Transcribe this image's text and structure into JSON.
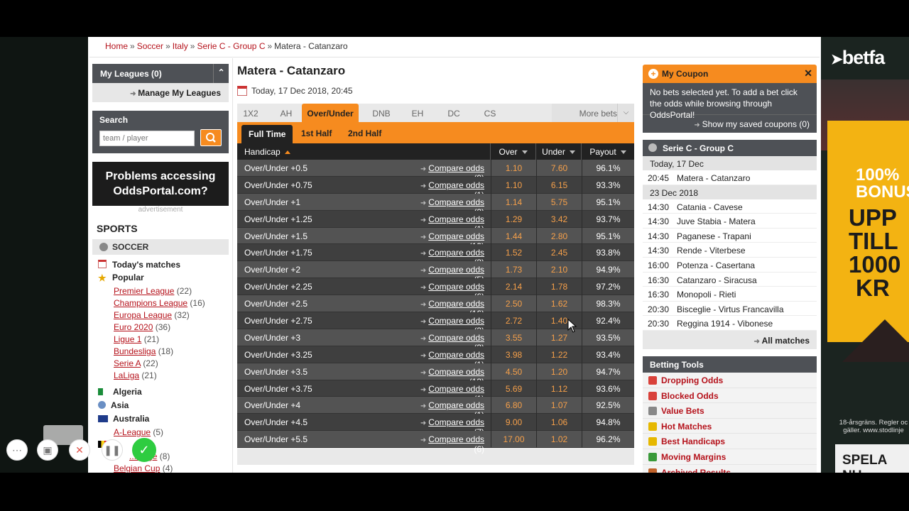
{
  "breadcrumb": [
    {
      "label": "Home"
    },
    {
      "label": "Soccer"
    },
    {
      "label": "Italy"
    },
    {
      "label": "Serie C - Group C"
    }
  ],
  "breadcrumb_current": "Matera - Catanzaro",
  "breadcrumb_sep": "»",
  "left": {
    "my_leagues": "My Leagues (0)",
    "manage": "Manage My Leagues",
    "search_title": "Search",
    "search_placeholder": "team / player",
    "problems": "Problems accessing OddsPortal.com?",
    "advertisement": "advertisement",
    "sports": "SPORTS",
    "soccer": "SOCCER",
    "todays_matches": "Today's matches",
    "popular": "Popular",
    "leagues": [
      {
        "name": "Premier League",
        "count": "(22)"
      },
      {
        "name": "Champions League",
        "count": "(16)"
      },
      {
        "name": "Europa League",
        "count": "(32)"
      },
      {
        "name": "Euro 2020",
        "count": "(36)"
      },
      {
        "name": "Ligue 1",
        "count": "(21)"
      },
      {
        "name": "Bundesliga",
        "count": "(18)"
      },
      {
        "name": "Serie A",
        "count": "(22)"
      },
      {
        "name": "LaLiga",
        "count": "(21)"
      }
    ],
    "countries": [
      "Algeria",
      "Asia",
      "Australia"
    ],
    "aus_league": {
      "name": "A-League",
      "count": "(5)"
    },
    "partial1": {
      "name": "...lenge",
      "count": "(8)"
    },
    "partial2": {
      "name": "Belgian Cup",
      "count": "(4)"
    }
  },
  "match": {
    "title": "Matera - Catanzaro",
    "date": "Today, 17 Dec 2018, 20:45"
  },
  "tabs": [
    "1X2",
    "AH",
    "Over/Under",
    "DNB",
    "EH",
    "DC",
    "CS"
  ],
  "active_tab": "Over/Under",
  "more_bets": "More bets",
  "subtabs": [
    "Full Time",
    "1st Half",
    "2nd Half"
  ],
  "table": {
    "headers": {
      "handicap": "Handicap",
      "over": "Over",
      "under": "Under",
      "payout": "Payout"
    },
    "compare_label": "Compare odds",
    "rows": [
      {
        "name": "Over/Under +0.5",
        "n": "(9)",
        "over": "1.10",
        "under": "7.60",
        "payout": "96.1%"
      },
      {
        "name": "Over/Under +0.75",
        "n": "(1)",
        "over": "1.10",
        "under": "6.15",
        "payout": "93.3%"
      },
      {
        "name": "Over/Under +1",
        "n": "(2)",
        "over": "1.14",
        "under": "5.75",
        "payout": "95.1%"
      },
      {
        "name": "Over/Under +1.25",
        "n": "(1)",
        "over": "1.29",
        "under": "3.42",
        "payout": "93.7%"
      },
      {
        "name": "Over/Under +1.5",
        "n": "(13)",
        "over": "1.44",
        "under": "2.80",
        "payout": "95.1%"
      },
      {
        "name": "Over/Under +1.75",
        "n": "(3)",
        "over": "1.52",
        "under": "2.45",
        "payout": "93.8%"
      },
      {
        "name": "Over/Under +2",
        "n": "(5)",
        "over": "1.73",
        "under": "2.10",
        "payout": "94.9%"
      },
      {
        "name": "Over/Under +2.25",
        "n": "(6)",
        "over": "2.14",
        "under": "1.78",
        "payout": "97.2%"
      },
      {
        "name": "Over/Under +2.5",
        "n": "(16)",
        "over": "2.50",
        "under": "1.62",
        "payout": "98.3%"
      },
      {
        "name": "Over/Under +2.75",
        "n": "(3)",
        "over": "2.72",
        "under": "1.40",
        "payout": "92.4%"
      },
      {
        "name": "Over/Under +3",
        "n": "(3)",
        "over": "3.55",
        "under": "1.27",
        "payout": "93.5%"
      },
      {
        "name": "Over/Under +3.25",
        "n": "(1)",
        "over": "3.98",
        "under": "1.22",
        "payout": "93.4%"
      },
      {
        "name": "Over/Under +3.5",
        "n": "(13)",
        "over": "4.50",
        "under": "1.20",
        "payout": "94.7%"
      },
      {
        "name": "Over/Under +3.75",
        "n": "(1)",
        "over": "5.69",
        "under": "1.12",
        "payout": "93.6%"
      },
      {
        "name": "Over/Under +4",
        "n": "(1)",
        "over": "6.80",
        "under": "1.07",
        "payout": "92.5%"
      },
      {
        "name": "Over/Under +4.5",
        "n": "(7)",
        "over": "9.00",
        "under": "1.06",
        "payout": "94.8%"
      },
      {
        "name": "Over/Under +5.5",
        "n": "(6)",
        "over": "17.00",
        "under": "1.02",
        "payout": "96.2%"
      }
    ]
  },
  "coupon": {
    "title": "My Coupon",
    "body": "No bets selected yet. To add a bet click the odds while browsing through OddsPortal!",
    "saved": "Show my saved coupons (0)"
  },
  "league_box": {
    "title": "Serie C - Group C",
    "day1": "Today, 17 Dec",
    "day1_matches": [
      {
        "time": "20:45",
        "teams": "Matera - Catanzaro"
      }
    ],
    "day2": "23 Dec 2018",
    "day2_matches": [
      {
        "time": "14:30",
        "teams": "Catania - Cavese"
      },
      {
        "time": "14:30",
        "teams": "Juve Stabia - Matera"
      },
      {
        "time": "14:30",
        "teams": "Paganese - Trapani"
      },
      {
        "time": "14:30",
        "teams": "Rende - Viterbese"
      },
      {
        "time": "16:00",
        "teams": "Potenza - Casertana"
      },
      {
        "time": "16:30",
        "teams": "Catanzaro - Siracusa"
      },
      {
        "time": "16:30",
        "teams": "Monopoli - Rieti"
      },
      {
        "time": "20:30",
        "teams": "Bisceglie - Virtus Francavilla"
      },
      {
        "time": "20:30",
        "teams": "Reggina 1914 - Vibonese"
      }
    ],
    "all_matches": "All matches"
  },
  "tools": {
    "title": "Betting Tools",
    "items": [
      {
        "label": "Dropping Odds",
        "icon": "arrow-down-icon",
        "color": "#d9413a"
      },
      {
        "label": "Blocked Odds",
        "icon": "cross-icon",
        "color": "#d9413a"
      },
      {
        "label": "Value Bets",
        "icon": "chart-icon",
        "color": "#888888"
      },
      {
        "label": "Hot Matches",
        "icon": "lightning-icon",
        "color": "#e6b800"
      },
      {
        "label": "Best Handicaps",
        "icon": "coin-icon",
        "color": "#e6b800"
      },
      {
        "label": "Moving Margins",
        "icon": "margins-icon",
        "color": "#3a9a3a"
      },
      {
        "label": "Archived Results",
        "icon": "archive-icon",
        "color": "#c0622a"
      }
    ]
  },
  "ad": {
    "logo": "betfa",
    "bonus_pct": "100%",
    "bonus_word": "BONUS",
    "upp": "UPP",
    "till": "TILL",
    "amount": "1000",
    "kr": "KR",
    "disclaimer": "18-årsgräns. Regler oc gäller. www.stodlinje",
    "cta": "SPELA NU"
  },
  "colors": {
    "accent": "#f68b1f",
    "link": "#b5121b",
    "dark": "#4e5156",
    "odds": "#f6a04a"
  }
}
